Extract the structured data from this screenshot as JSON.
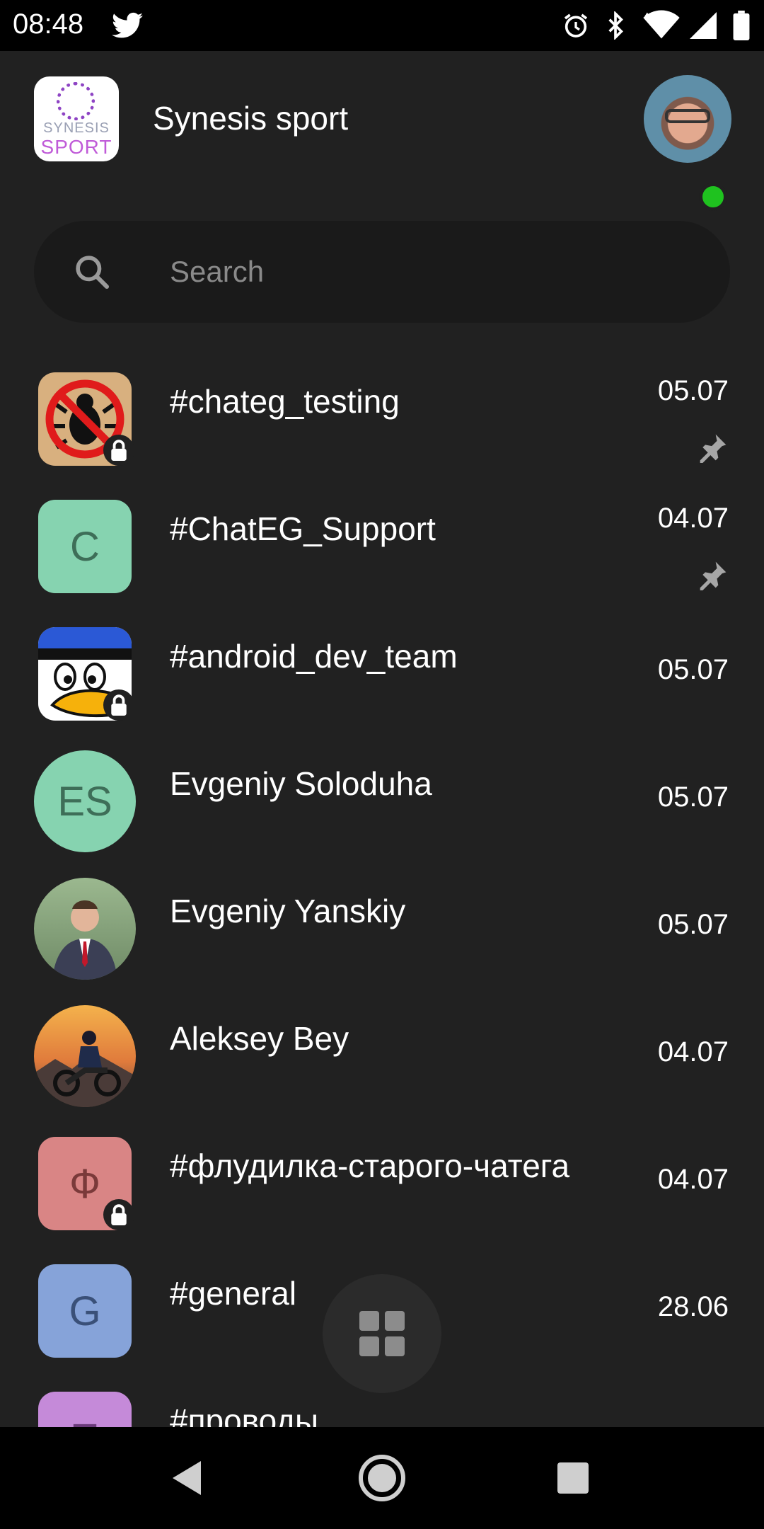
{
  "status_bar": {
    "time": "08:48",
    "icons": [
      "twitter-icon",
      "alarm-icon",
      "bluetooth-icon",
      "wifi-icon",
      "signal-icon",
      "battery-icon"
    ]
  },
  "header": {
    "logo_text_top": "SYNESIS",
    "logo_text_bottom": "SPORT",
    "workspace_name": "Synesis sport",
    "user_status": "online"
  },
  "search": {
    "placeholder": "Search",
    "value": ""
  },
  "chats": [
    {
      "name": "#chateg_testing",
      "date": "05.07",
      "pinned": true,
      "locked": true,
      "avatar": "bug-image"
    },
    {
      "name": "#ChatEG_Support",
      "date": "04.07",
      "pinned": true,
      "locked": false,
      "avatar_letter": "C",
      "avatar_color": "#86d3b0"
    },
    {
      "name": "#android_dev_team",
      "date": "05.07",
      "pinned": false,
      "locked": true,
      "avatar": "duck-image"
    },
    {
      "name": "Evgeniy Soloduha",
      "date": "05.07",
      "pinned": false,
      "locked": false,
      "avatar_letter": "ES",
      "avatar_color": "#86d3b0"
    },
    {
      "name": "Evgeniy Yanskiy",
      "date": "05.07",
      "pinned": false,
      "locked": false,
      "avatar": "person-photo"
    },
    {
      "name": "Aleksey Bey",
      "date": "04.07",
      "pinned": false,
      "locked": false,
      "avatar": "motorcycle-photo"
    },
    {
      "name": "#флудилка-старого-чатега",
      "date": "04.07",
      "pinned": false,
      "locked": true,
      "avatar_letter": "Ф",
      "avatar_color": "#d98585"
    },
    {
      "name": "#general",
      "date": "28.06",
      "pinned": false,
      "locked": false,
      "avatar_letter": "G",
      "avatar_color": "#86a3d9"
    },
    {
      "name": "#проводы",
      "date": "",
      "pinned": false,
      "locked": false,
      "avatar_letter": "П",
      "avatar_color": "#c58ad9"
    }
  ],
  "colors": {
    "background": "#212121",
    "search_bg": "#1a1a1a",
    "online": "#1fc21f"
  }
}
